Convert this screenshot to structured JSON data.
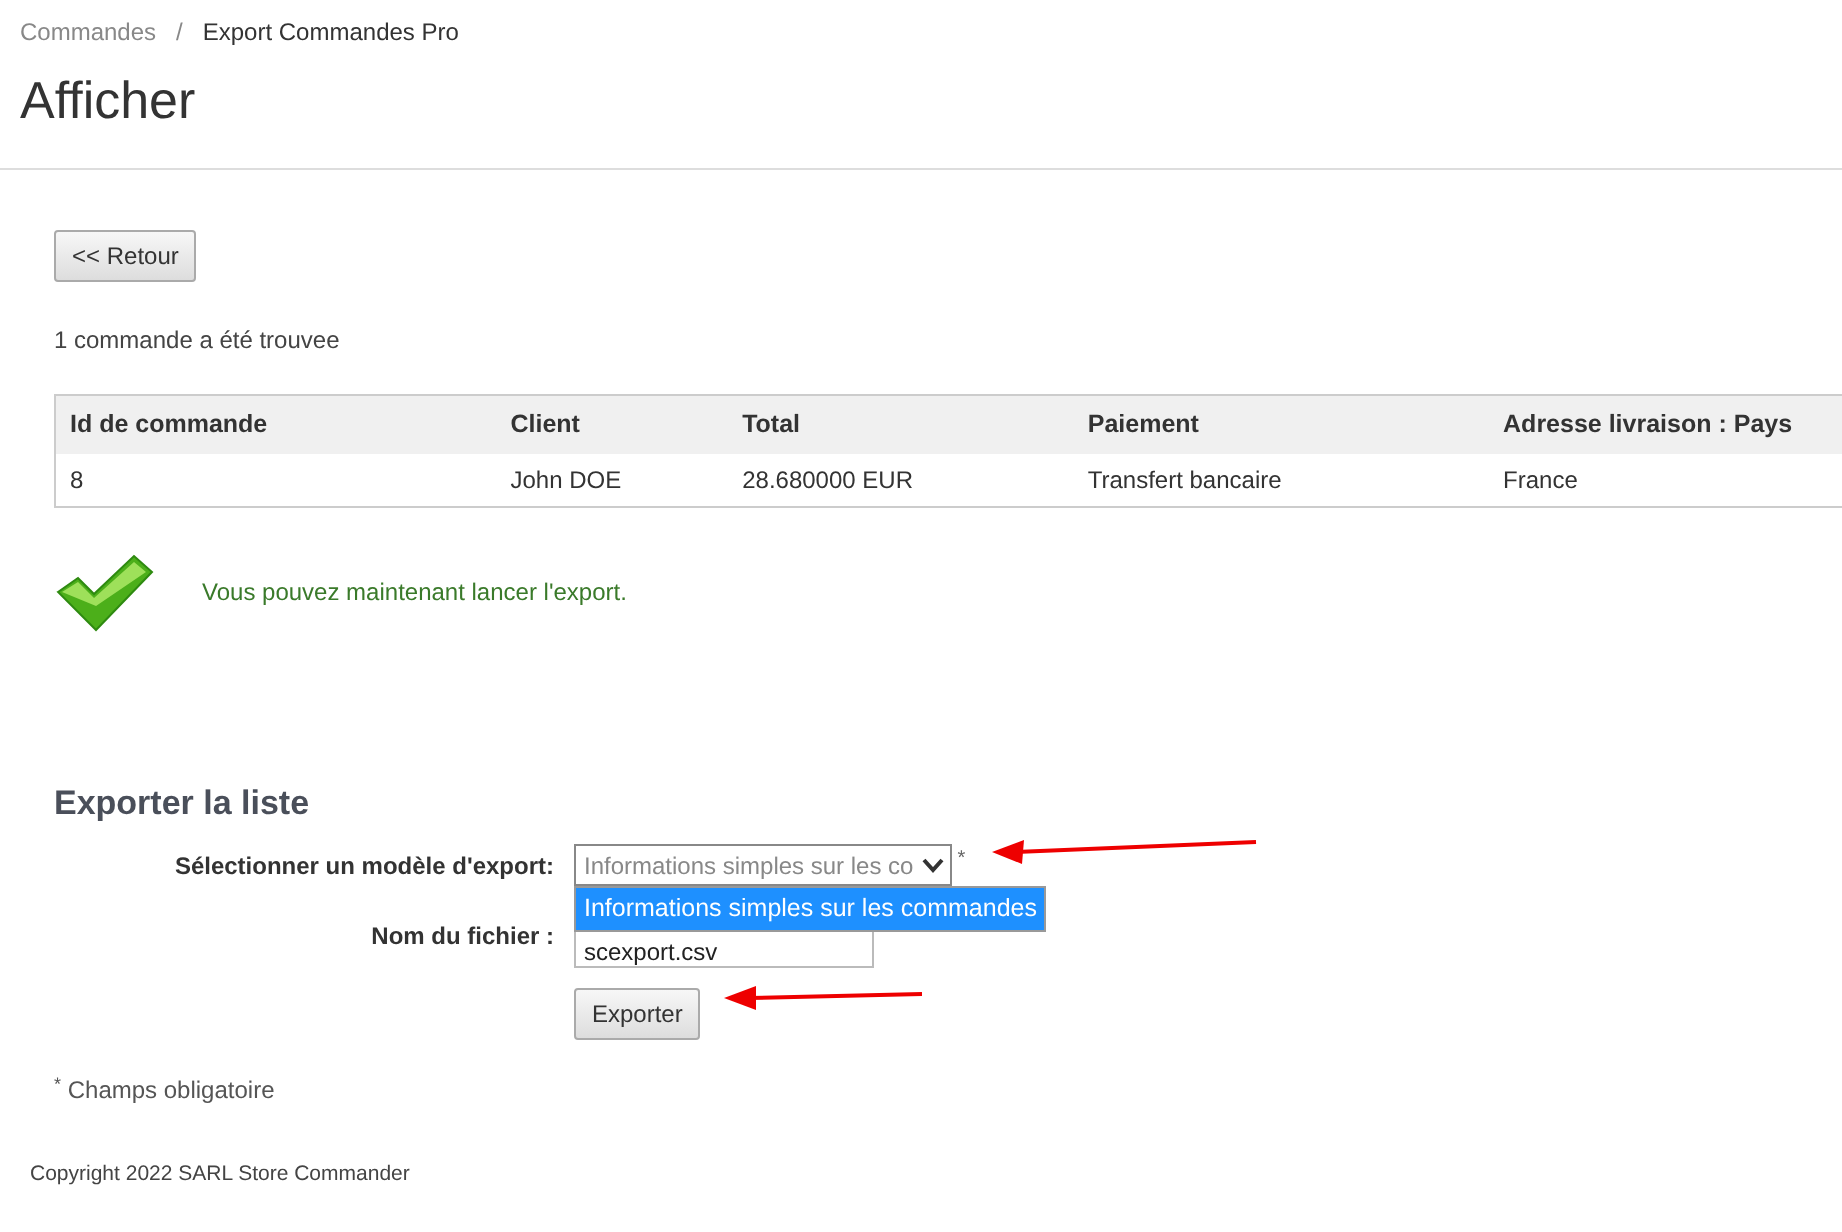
{
  "breadcrumb": [
    {
      "label": "Commandes"
    },
    {
      "label": "Export Commandes Pro"
    }
  ],
  "breadcrumb_separator": "/",
  "title": "Afficher",
  "back_button": "<< Retour",
  "result_count": "1 commande a été trouvee",
  "table": {
    "columns": [
      "Id de commande",
      "Client",
      "Total",
      "Paiement",
      "Adresse livraison : Pays"
    ],
    "rows": [
      [
        "8",
        "John DOE",
        "28.680000 EUR",
        "Transfert bancaire",
        "France"
      ]
    ]
  },
  "success_message": "Vous pouvez maintenant lancer l'export.",
  "export_section": {
    "heading": "Exporter la liste",
    "template_field": {
      "label": "Sélectionner un modèle d'export:",
      "value": "Informations simples sur les co",
      "required_mark": "*",
      "expanded": true,
      "options": [
        {
          "label": "Informations simples sur les commandes",
          "selected": true
        }
      ]
    },
    "filename_field": {
      "label": "Nom du fichier :",
      "value": "scexport.csv"
    },
    "submit_button": "Exporter"
  },
  "required_note": {
    "mark": "*",
    "text": "Champs obligatoire"
  },
  "footer": "Copyright 2022 SARL Store Commander"
}
